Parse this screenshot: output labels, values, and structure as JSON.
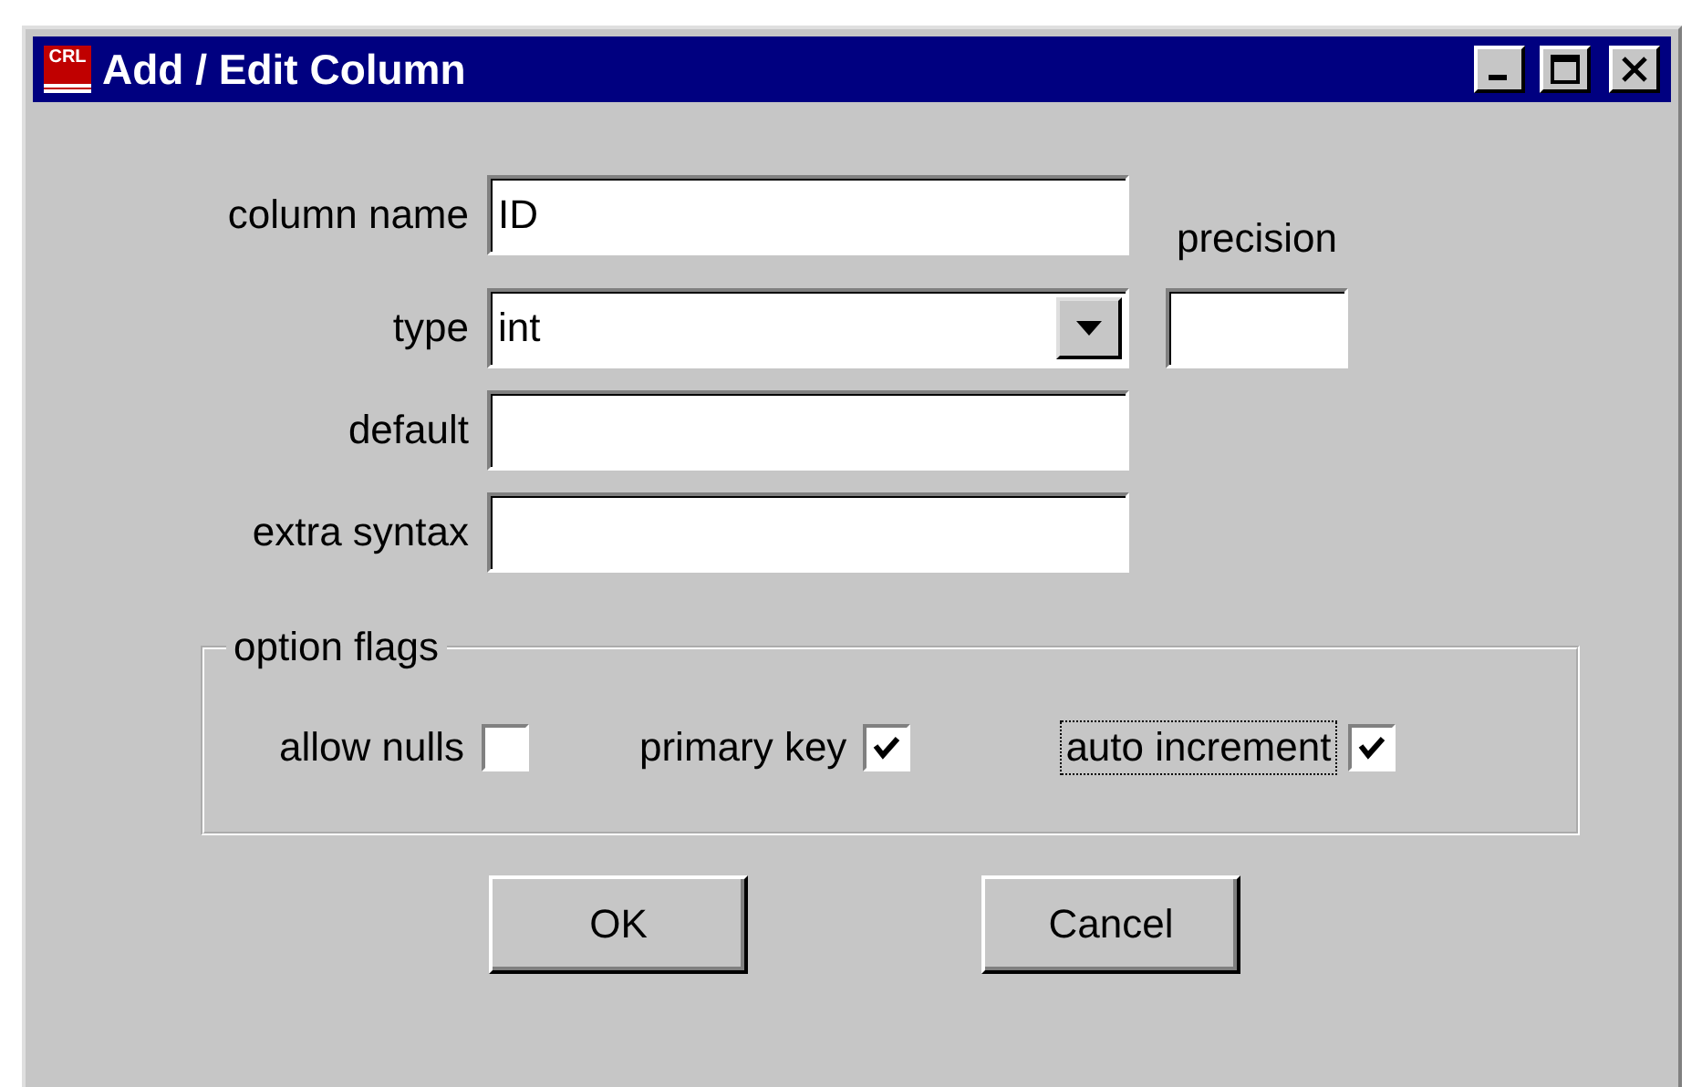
{
  "window": {
    "icon_text": "CRL",
    "title": "Add / Edit Column"
  },
  "fields": [
    {
      "label": "column name",
      "value": "ID",
      "kind": "text"
    },
    {
      "label": "type",
      "value": "int",
      "kind": "dropdown"
    },
    {
      "label": "default",
      "kind": "text"
    },
    {
      "label": "extra syntax",
      "kind": "text"
    }
  ],
  "precision": {
    "label": "precision"
  },
  "option_flags": {
    "title": "option flags",
    "items": [
      {
        "label": "allow nulls",
        "checked": false,
        "focused": false
      },
      {
        "label": "primary key",
        "checked": true,
        "focused": false
      },
      {
        "label": "auto increment",
        "checked": true,
        "focused": true
      }
    ]
  },
  "buttons": [
    "OK",
    "Cancel"
  ]
}
